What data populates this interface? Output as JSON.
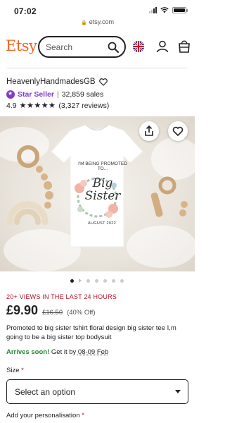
{
  "status_bar": {
    "time": "07:02"
  },
  "url_bar": {
    "domain": "etsy.com"
  },
  "header": {
    "logo": "Etsy",
    "search_placeholder": "Search",
    "icons": [
      "search-icon",
      "uk-flag-icon",
      "user-icon",
      "shopping-bag-icon"
    ]
  },
  "shop": {
    "name": "HeavenlyHandmadesGB",
    "badge": "Star Seller",
    "sales": "32,859 sales",
    "rating": "4.9",
    "stars": "★★★★★",
    "reviews": "(3,327 reviews)"
  },
  "image": {
    "shirt_line1": "I'M BEING PROMOTED TO...",
    "shirt_big": "Big Sister",
    "shirt_date": "AUGUST 2022",
    "dot_count": 7,
    "active_dot": 0
  },
  "listing": {
    "views": "20+ VIEWS IN THE LAST 24 HOURS",
    "price": "£9.90",
    "old_price": "£16.50",
    "discount": "(40% Off)",
    "title": "Promoted to big sister tshirt floral design big sister tee I,m going to be a big sister top bodysuit",
    "arrives_label": "Arrives soon!",
    "arrives_text": "Get it by",
    "arrives_date": "08-09 Feb"
  },
  "options": {
    "size_label": "Size",
    "required_mark": "*",
    "size_select": "Select an option",
    "personalisation_label": "Add your personalisation"
  },
  "colors": {
    "brand": "#f1641e",
    "star_seller": "#7f3cc7",
    "alert": "#b3132a",
    "arrives": "#258635"
  }
}
